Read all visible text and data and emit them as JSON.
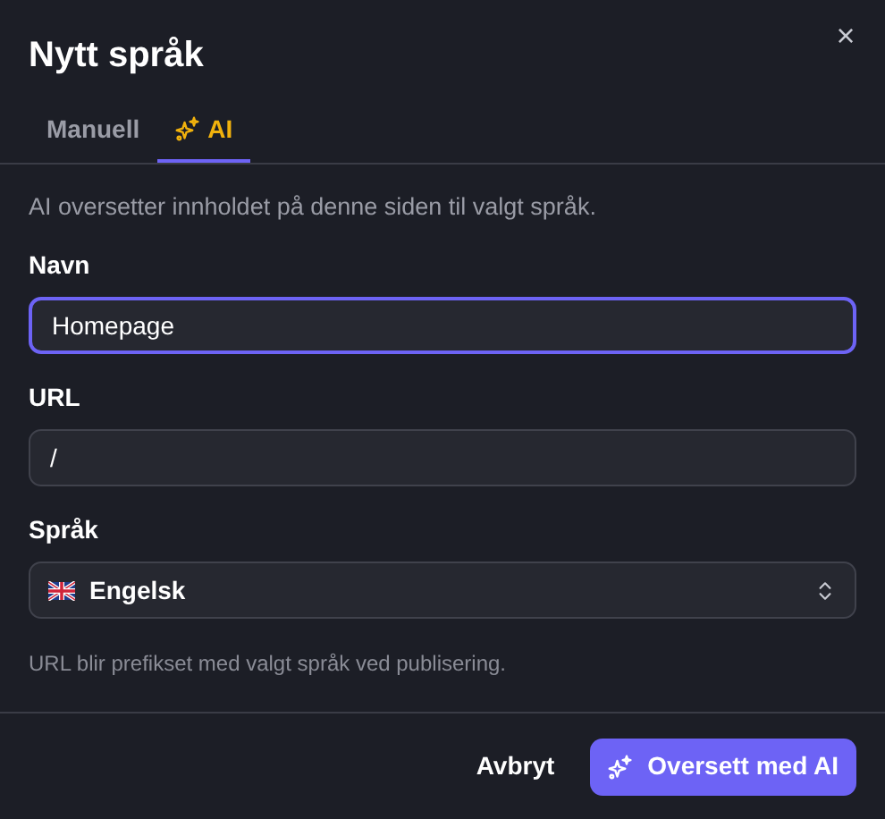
{
  "dialog": {
    "title": "Nytt språk",
    "close_label": "×"
  },
  "tabs": [
    {
      "label": "Manuell",
      "selected": false,
      "kind": "plain"
    },
    {
      "label": "AI",
      "selected": true,
      "kind": "ai"
    }
  ],
  "description": "AI oversetter innholdet på denne siden til valgt språk.",
  "fields": [
    {
      "kind": "input",
      "label": "Navn",
      "value": "Homepage",
      "focused": true
    },
    {
      "kind": "input",
      "label": "URL",
      "value": "/",
      "focused": false
    },
    {
      "kind": "select",
      "label": "Språk",
      "value": "Engelsk",
      "focused": false
    }
  ],
  "hint": "URL blir prefikset med valgt språk ved publisering.",
  "buttons": [
    {
      "label": "Avbryt",
      "kind": "cancel"
    },
    {
      "label": "Oversett med AI",
      "kind": "primary"
    }
  ]
}
